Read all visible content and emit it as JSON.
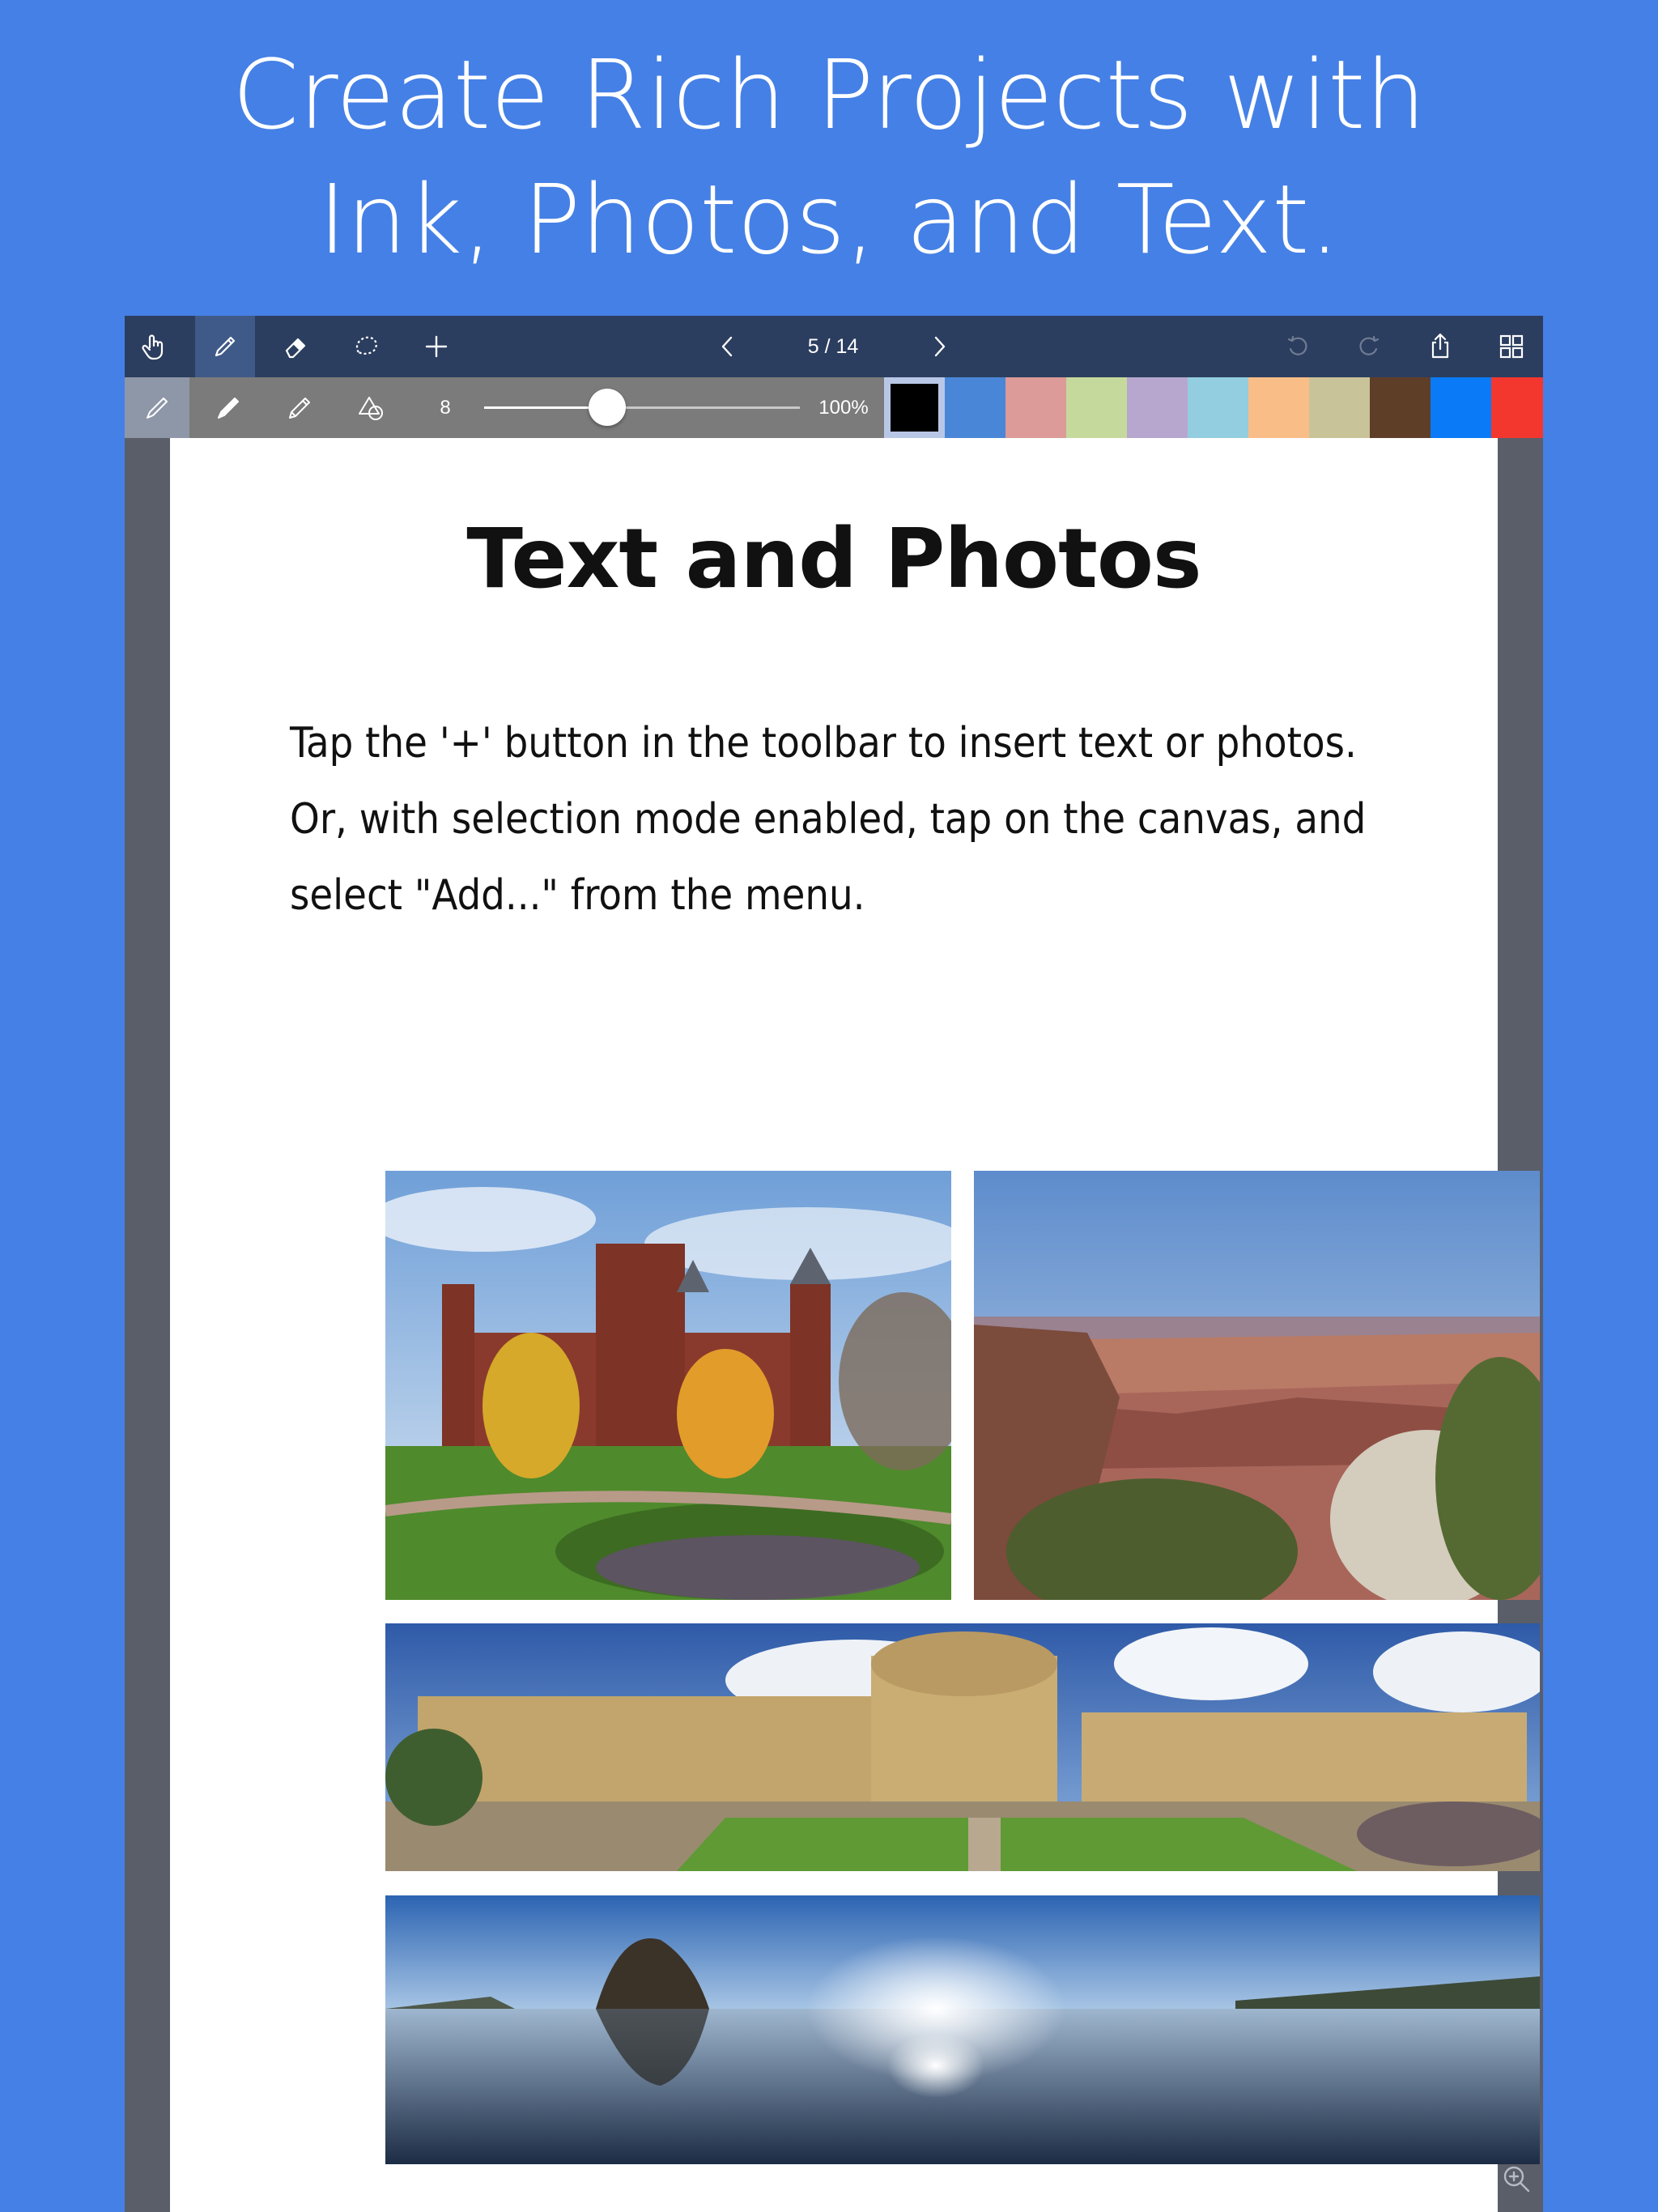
{
  "headline": {
    "line1": "Create Rich Projects with",
    "line2": "Ink, Photos, and Text."
  },
  "toolbar": {
    "left_tools": [
      "hand-icon",
      "pen-icon",
      "eraser-icon",
      "lasso-icon",
      "plus-icon"
    ],
    "page_counter": "5 / 14",
    "right_tools": [
      "undo-icon",
      "redo-icon",
      "share-icon",
      "grid-icon"
    ],
    "accent": "#3f5a88"
  },
  "brush_bar": {
    "tools": [
      "pen-nib-icon",
      "marker-icon",
      "pencil-icon",
      "shapes-icon"
    ],
    "size": "8",
    "opacity": "100%",
    "slider_fraction": 0.39,
    "colors": [
      "#000000",
      "#4a86d8",
      "#dc9a98",
      "#c5d99d",
      "#b7a7cf",
      "#92cde0",
      "#f9bd88",
      "#c9c39a",
      "#5f3e28",
      "#0a7af7",
      "#f3372f"
    ],
    "selected_color": "#000000"
  },
  "page": {
    "title": "Text and Photos",
    "body": [
      "Tap the '+' button in the toolbar to insert text or photos.",
      "Or, with selection mode enabled, tap on the canvas, and",
      "select \"Add...\" from the menu."
    ],
    "photos": [
      "castle-photo",
      "canyon-photo",
      "campus-panorama-photo",
      "beach-panorama-photo"
    ]
  },
  "zoom_icon": "zoom-in-icon"
}
